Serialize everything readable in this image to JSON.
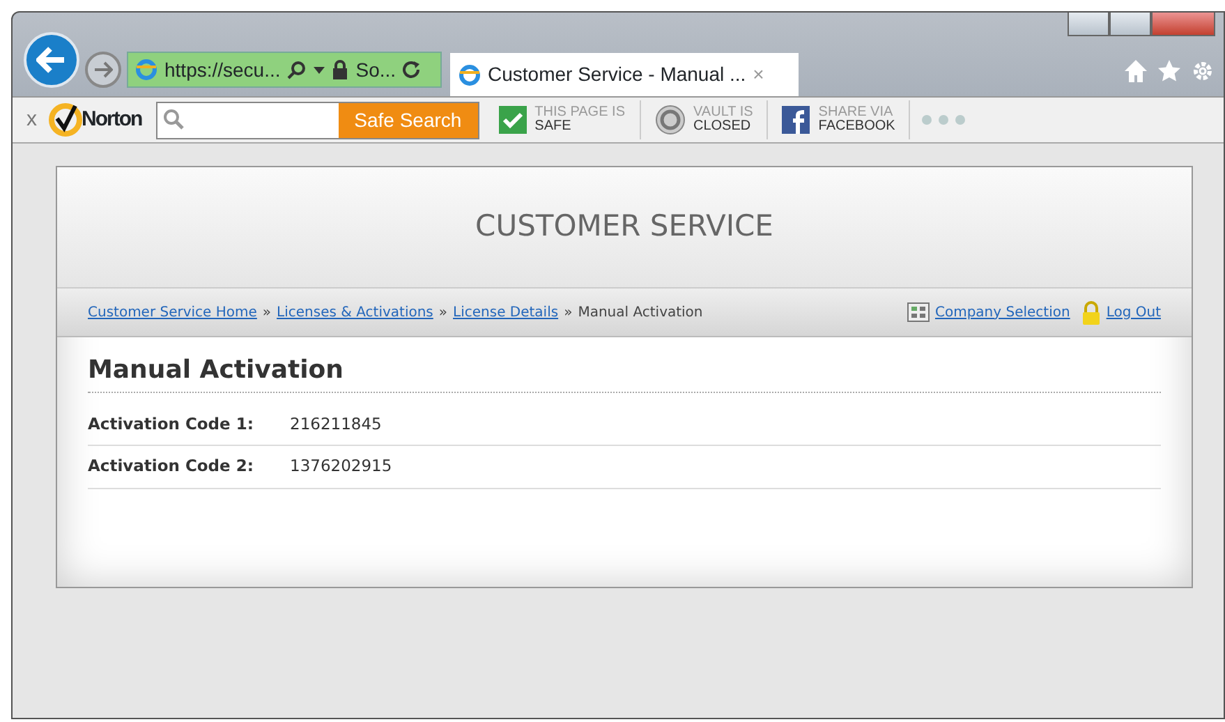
{
  "browser": {
    "address": "https://secu...",
    "site_identity": "So...",
    "tab_title": "Customer Service - Manual ...",
    "tab_close": "×"
  },
  "norton": {
    "close": "x",
    "brand": "Norton",
    "search_button": "Safe Search",
    "widgets": [
      {
        "kind": "check",
        "caption": "THIS PAGE IS",
        "value": "SAFE"
      },
      {
        "kind": "vault",
        "caption": "VAULT IS",
        "value": "CLOSED"
      },
      {
        "kind": "facebook",
        "caption": "SHARE VIA",
        "value": "FACEBOOK"
      }
    ]
  },
  "page": {
    "header": "CUSTOMER SERVICE",
    "breadcrumb": [
      {
        "kind": "link",
        "label": "Customer Service Home"
      },
      {
        "kind": "sep",
        "label": "»"
      },
      {
        "kind": "link",
        "label": "Licenses & Activations"
      },
      {
        "kind": "sep",
        "label": "»"
      },
      {
        "kind": "link",
        "label": "License Details"
      },
      {
        "kind": "sep",
        "label": "»"
      },
      {
        "kind": "current",
        "label": "Manual Activation"
      }
    ],
    "actions": [
      {
        "kind": "grid",
        "label": "Company Selection"
      },
      {
        "kind": "lock",
        "label": "Log Out"
      }
    ],
    "title": "Manual Activation",
    "fields": [
      {
        "label": "Activation Code 1:",
        "value": "216211845"
      },
      {
        "label": "Activation Code 2:",
        "value": "1376202915"
      }
    ]
  }
}
